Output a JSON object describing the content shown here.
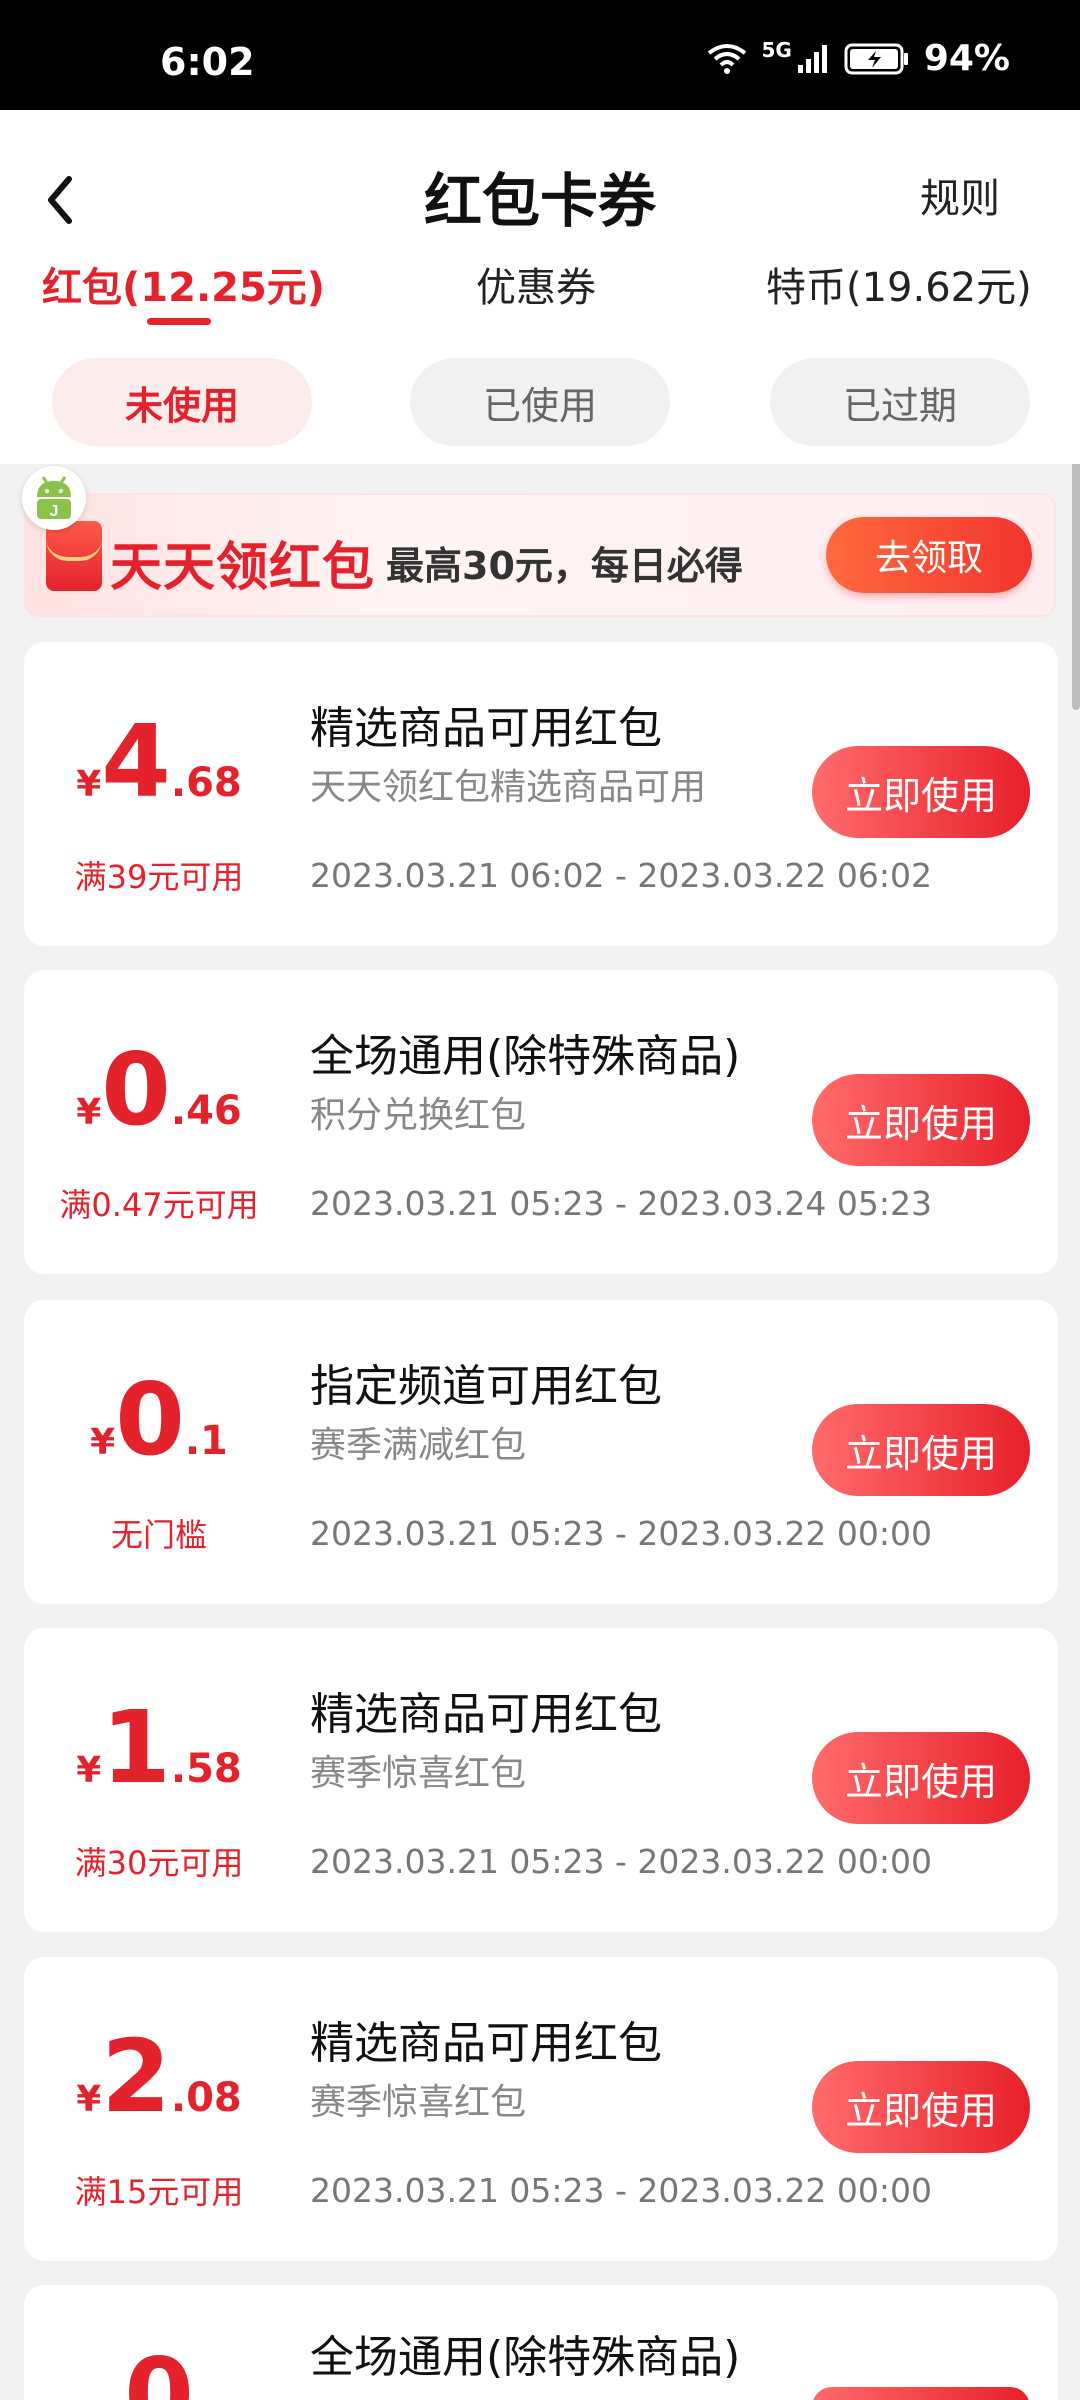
{
  "status_bar": {
    "time": "6:02",
    "network": "5G",
    "battery": "94%"
  },
  "header": {
    "title": "红包卡券",
    "rules": "规则"
  },
  "tabs": [
    {
      "label": "红包(12.25元)",
      "active": true
    },
    {
      "label": "优惠券",
      "active": false
    },
    {
      "label": "特币(19.62元)",
      "active": false
    }
  ],
  "filters": [
    {
      "label": "未使用",
      "active": true
    },
    {
      "label": "已使用",
      "active": false
    },
    {
      "label": "已过期",
      "active": false
    }
  ],
  "banner": {
    "title": "天天领红包",
    "subtitle": "最高30元，每日必得",
    "button": "去领取"
  },
  "coupons": [
    {
      "currency": "¥",
      "int": "4",
      "dec": ".68",
      "threshold": "满39元可用",
      "title": "精选商品可用红包",
      "subtitle": "天天领红包精选商品可用",
      "date": "2023.03.21 06:02 - 2023.03.22 06:02",
      "button": "立即使用"
    },
    {
      "currency": "¥",
      "int": "0",
      "dec": ".46",
      "threshold": "满0.47元可用",
      "title": "全场通用(除特殊商品)",
      "subtitle": "积分兑换红包",
      "date": "2023.03.21 05:23 - 2023.03.24 05:23",
      "button": "立即使用"
    },
    {
      "currency": "¥",
      "int": "0",
      "dec": ".1",
      "threshold": "无门槛",
      "title": "指定频道可用红包",
      "subtitle": "赛季满减红包",
      "date": "2023.03.21 05:23 - 2023.03.22 00:00",
      "button": "立即使用"
    },
    {
      "currency": "¥",
      "int": "1",
      "dec": ".58",
      "threshold": "满30元可用",
      "title": "精选商品可用红包",
      "subtitle": "赛季惊喜红包",
      "date": "2023.03.21 05:23 - 2023.03.22 00:00",
      "button": "立即使用"
    },
    {
      "currency": "¥",
      "int": "2",
      "dec": ".08",
      "threshold": "满15元可用",
      "title": "精选商品可用红包",
      "subtitle": "赛季惊喜红包",
      "date": "2023.03.21 05:23 - 2023.03.22 00:00",
      "button": "立即使用"
    },
    {
      "currency": "",
      "int": "0",
      "dec": "",
      "threshold": "",
      "title": "全场通用(除特殊商品)",
      "subtitle": "",
      "date": "",
      "button": ""
    }
  ],
  "colors": {
    "accent": "#e4222c",
    "background": "#f2f2f2"
  }
}
